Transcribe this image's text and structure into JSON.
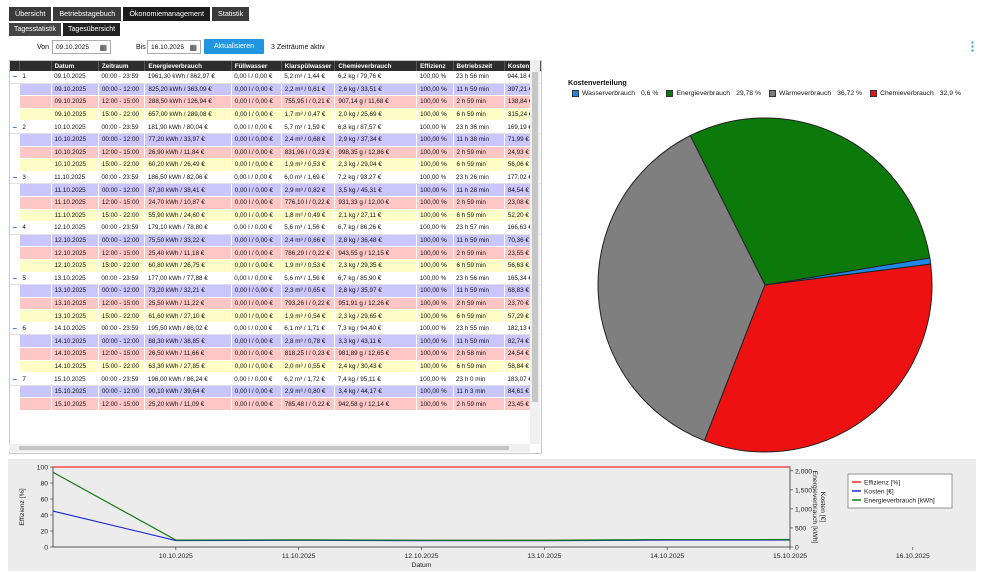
{
  "tabs": [
    "Übersicht",
    "Betriebstagebuch",
    "Ökonomiemanagement",
    "Statistik"
  ],
  "subtabs": [
    "Tagesstatistik",
    "Tagesübersicht"
  ],
  "filter": {
    "von_label": "Von",
    "von_value": "09.10.2025",
    "bis_label": "Bis",
    "bis_value": "16.10.2025",
    "button": "Aktualisieren",
    "status": "3 Zeiträume aktiv"
  },
  "table": {
    "columns": [
      "",
      "",
      "Datum",
      "Zeitraum",
      "Energieverbrauch",
      "Füllwasser",
      "Klarspülwasser",
      "Chemieverbrauch",
      "Effizienz",
      "Betriebszeit",
      "Kosten"
    ],
    "groups": [
      {
        "n": "1",
        "rows": [
          [
            "09.10.2025",
            "00:00 - 23:59",
            "1961,30 kWh / 862,97 €",
            "0,00 l / 0,00 €",
            "5,2 m³ / 1,44 €",
            "6,2 kg / 79,76 €",
            "100,00 %",
            "23 h 56 min",
            "944,18 €"
          ],
          [
            "09.10.2025",
            "00:00 - 12:00",
            "825,20 kWh / 363,09 €",
            "0,00 l / 0,00 €",
            "2,2 m³ / 0,61 €",
            "2,6 kg / 33,51 €",
            "100,00 %",
            "11 h 59 min",
            "397,21 €"
          ],
          [
            "09.10.2025",
            "12:00 - 15:00",
            "288,50 kWh / 126,94 €",
            "0,00 l / 0,00 €",
            "755,95 l / 0,21 €",
            "907,14 g / 11,68 €",
            "100,00 %",
            "2 h 59 min",
            "138,84 €"
          ],
          [
            "09.10.2025",
            "15:00 - 22:00",
            "657,00 kWh / 289,08 €",
            "0,00 l / 0,00 €",
            "1,7 m³ / 0,47 €",
            "2,0 kg / 25,69 €",
            "100,00 %",
            "6 h 59 min",
            "315,24 €"
          ]
        ]
      },
      {
        "n": "2",
        "rows": [
          [
            "10.10.2025",
            "00:00 - 23:59",
            "181,90 kWh / 80,04 €",
            "0,00 l / 0,00 €",
            "5,7 m³ / 1,59 €",
            "6,8 kg / 87,57 €",
            "100,00 %",
            "23 h 36 min",
            "169,19 €"
          ],
          [
            "10.10.2025",
            "00:00 - 12:00",
            "77,20 kWh / 33,97 €",
            "0,00 l / 0,00 €",
            "2,4 m³ / 0,68 €",
            "2,9 kg / 37,34 €",
            "100,00 %",
            "11 h 38 min",
            "71,99 €"
          ],
          [
            "10.10.2025",
            "12:00 - 15:00",
            "26,90 kWh / 11,84 €",
            "0,00 l / 0,00 €",
            "831,96 l / 0,23 €",
            "998,35 g / 12,86 €",
            "100,00 %",
            "2 h 59 min",
            "24,93 €"
          ],
          [
            "10.10.2025",
            "15:00 - 22:00",
            "60,20 kWh / 26,49 €",
            "0,00 l / 0,00 €",
            "1,9 m³ / 0,53 €",
            "2,3 kg / 29,04 €",
            "100,00 %",
            "6 h 59 min",
            "56,06 €"
          ]
        ]
      },
      {
        "n": "3",
        "rows": [
          [
            "11.10.2025",
            "00:00 - 23:59",
            "186,50 kWh / 82,06 €",
            "0,00 l / 0,00 €",
            "6,0 m³ / 1,69 €",
            "7,2 kg / 93,27 €",
            "100,00 %",
            "23 h 26 min",
            "177,02 €"
          ],
          [
            "11.10.2025",
            "00:00 - 12:00",
            "87,30 kWh / 38,41 €",
            "0,00 l / 0,00 €",
            "2,9 m³ / 0,82 €",
            "3,5 kg / 45,31 €",
            "100,00 %",
            "11 h 28 min",
            "84,54 €"
          ],
          [
            "11.10.2025",
            "12:00 - 15:00",
            "24,70 kWh / 10,87 €",
            "0,00 l / 0,00 €",
            "776,10 l / 0,22 €",
            "931,33 g / 12,00 €",
            "100,00 %",
            "2 h 59 min",
            "23,08 €"
          ],
          [
            "11.10.2025",
            "15:00 - 22:00",
            "55,90 kWh / 24,60 €",
            "0,00 l / 0,00 €",
            "1,8 m³ / 0,49 €",
            "2,1 kg / 27,11 €",
            "100,00 %",
            "6 h 59 min",
            "52,20 €"
          ]
        ]
      },
      {
        "n": "4",
        "rows": [
          [
            "12.10.2025",
            "00:00 - 23:59",
            "179,10 kWh / 78,80 €",
            "0,00 l / 0,00 €",
            "5,6 m³ / 1,56 €",
            "6,7 kg / 86,26 €",
            "100,00 %",
            "23 h 57 min",
            "166,63 €"
          ],
          [
            "12.10.2025",
            "00:00 - 12:00",
            "75,50 kWh / 33,22 €",
            "0,00 l / 0,00 €",
            "2,4 m³ / 0,66 €",
            "2,8 kg / 36,48 €",
            "100,00 %",
            "11 h 59 min",
            "70,36 €"
          ],
          [
            "12.10.2025",
            "12:00 - 15:00",
            "25,40 kWh / 11,18 €",
            "0,00 l / 0,00 €",
            "786,29 l / 0,22 €",
            "943,55 g / 12,15 €",
            "100,00 %",
            "2 h 59 min",
            "23,55 €"
          ],
          [
            "12.10.2025",
            "15:00 - 22:00",
            "60,80 kWh / 26,75 €",
            "0,00 l / 0,00 €",
            "1,9 m³ / 0,53 €",
            "2,3 kg / 29,35 €",
            "100,00 %",
            "6 h 59 min",
            "56,63 €"
          ]
        ]
      },
      {
        "n": "5",
        "rows": [
          [
            "13.10.2025",
            "00:00 - 23:59",
            "177,00 kWh / 77,88 €",
            "0,00 l / 0,00 €",
            "5,6 m³ / 1,56 €",
            "6,7 kg / 85,90 €",
            "100,00 %",
            "23 h 56 min",
            "165,34 €"
          ],
          [
            "13.10.2025",
            "00:00 - 12:00",
            "73,20 kWh / 32,21 €",
            "0,00 l / 0,00 €",
            "2,3 m³ / 0,65 €",
            "2,8 kg / 35,97 €",
            "100,00 %",
            "11 h 59 min",
            "68,83 €"
          ],
          [
            "13.10.2025",
            "12:00 - 15:00",
            "25,50 kWh / 11,22 €",
            "0,00 l / 0,00 €",
            "793,26 l / 0,22 €",
            "951,91 g / 12,26 €",
            "100,00 %",
            "2 h 59 min",
            "23,70 €"
          ],
          [
            "13.10.2025",
            "15:00 - 22:00",
            "61,60 kWh / 27,10 €",
            "0,00 l / 0,00 €",
            "1,9 m³ / 0,54 €",
            "2,3 kg / 29,65 €",
            "100,00 %",
            "6 h 59 min",
            "57,29 €"
          ]
        ]
      },
      {
        "n": "6",
        "rows": [
          [
            "14.10.2025",
            "00:00 - 23:59",
            "195,50 kWh / 86,02 €",
            "0,00 l / 0,00 €",
            "6,1 m³ / 1,71 €",
            "7,3 kg / 94,40 €",
            "100,00 %",
            "23 h 55 min",
            "182,13 €"
          ],
          [
            "14.10.2025",
            "00:00 - 12:00",
            "88,30 kWh / 38,85 €",
            "0,00 l / 0,00 €",
            "2,8 m³ / 0,78 €",
            "3,3 kg / 43,11 €",
            "100,00 %",
            "11 h 59 min",
            "82,74 €"
          ],
          [
            "14.10.2025",
            "12:00 - 15:00",
            "26,50 kWh / 11,66 €",
            "0,00 l / 0,00 €",
            "818,25 l / 0,23 €",
            "981,89 g / 12,65 €",
            "100,00 %",
            "2 h 58 min",
            "24,54 €"
          ],
          [
            "14.10.2025",
            "15:00 - 22:00",
            "63,30 kWh / 27,85 €",
            "0,00 l / 0,00 €",
            "2,0 m³ / 0,55 €",
            "2,4 kg / 30,43 €",
            "100,00 %",
            "6 h 59 min",
            "58,84 €"
          ]
        ]
      },
      {
        "n": "7",
        "rows": [
          [
            "15.10.2025",
            "00:00 - 23:59",
            "196,00 kWh / 86,24 €",
            "0,00 l / 0,00 €",
            "6,2 m³ / 1,72 €",
            "7,4 kg / 95,11 €",
            "100,00 %",
            "23 h 0 min",
            "183,07 €"
          ],
          [
            "15.10.2025",
            "00:00 - 12:00",
            "90,10 kWh / 39,64 €",
            "0,00 l / 0,00 €",
            "2,9 m³ / 0,80 €",
            "3,4 kg / 44,17 €",
            "100,00 %",
            "11 h 3 min",
            "84,61 €"
          ],
          [
            "15.10.2025",
            "12:00 - 15:00",
            "25,20 kWh / 11,09 €",
            "0,00 l / 0,00 €",
            "785,48 l / 0,22 €",
            "942,58 g / 12,14 €",
            "100,00 %",
            "2 h 59 min",
            "23,45 €"
          ]
        ]
      }
    ]
  },
  "pie": {
    "title": "Kostenverteilung",
    "slices": [
      {
        "label": "Wasserverbrauch",
        "pct": "0,6 %",
        "value": 0.6,
        "color": "#1e88e5"
      },
      {
        "label": "Energieverbrauch",
        "pct": "29,78 %",
        "value": 29.78,
        "color": "#0b7a0b"
      },
      {
        "label": "Wärmeverbrauch",
        "pct": "36,72 %",
        "value": 36.72,
        "color": "#7f7f7f"
      },
      {
        "label": "Chemieverbrauch",
        "pct": "32,9 %",
        "value": 32.9,
        "color": "#ee1111"
      }
    ]
  },
  "chart_data": {
    "type": "line",
    "xlabel": "Datum",
    "ylabel_left": "Effizienz [%]",
    "ylabel_right": "Kosten [€]\nEnergieverbrauch [kWh]",
    "x_ticks": [
      "10.10.2025",
      "11.10.2025",
      "12.10.2025",
      "13.10.2025",
      "14.10.2025",
      "15.10.2025",
      "16.10.2025"
    ],
    "y_left_ticks": [
      0,
      20,
      40,
      60,
      80,
      100
    ],
    "y_left_lim": [
      0,
      100
    ],
    "y_right_ticks": [
      "0",
      "500",
      "1,000",
      "1,500",
      "2,000"
    ],
    "y_right_lim": [
      0,
      2100
    ],
    "x": [
      "09.10.2025",
      "10.10.2025",
      "11.10.2025",
      "12.10.2025",
      "13.10.2025",
      "14.10.2025",
      "15.10.2025"
    ],
    "series": [
      {
        "name": "Effizienz [%]",
        "axis": "left",
        "color": "#ff2a2a",
        "values": [
          100,
          100,
          100,
          100,
          100,
          100,
          100
        ]
      },
      {
        "name": "Kosten [€]",
        "axis": "right",
        "color": "#1a2ad8",
        "values": [
          944.18,
          169.19,
          177.02,
          166.63,
          165.34,
          182.13,
          183.07
        ]
      },
      {
        "name": "Energieverbrauch [kWh]",
        "axis": "right",
        "color": "#147a14",
        "values": [
          1961.3,
          181.9,
          186.5,
          179.1,
          177.0,
          195.5,
          196.0
        ]
      }
    ]
  }
}
